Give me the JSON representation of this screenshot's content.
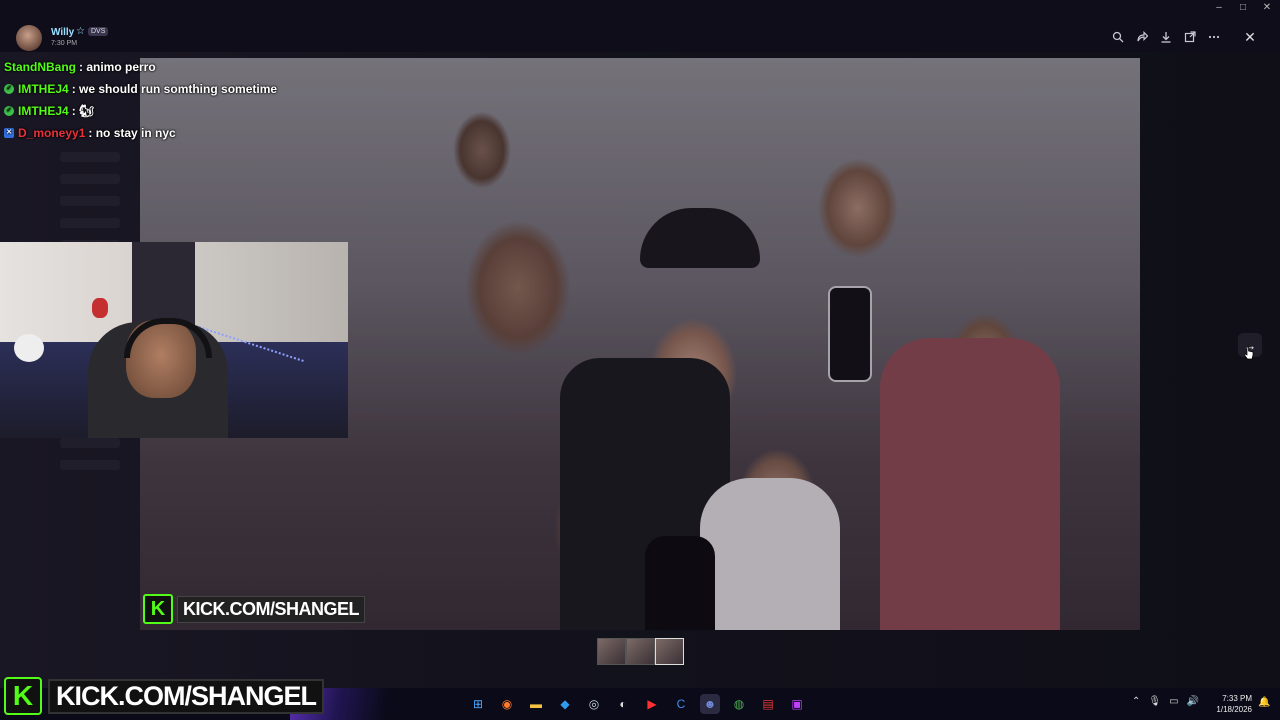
{
  "viewer": {
    "user_name": "Willy",
    "user_star": "☆",
    "user_badge": "DVS",
    "time": "7:30 PM",
    "toolbar_icons": [
      "zoom-icon",
      "share-icon",
      "download-icon",
      "open-external-icon",
      "more-icon"
    ],
    "close_label": "✕"
  },
  "window_controls": {
    "minimize": "–",
    "maximize": "□",
    "close": "✕"
  },
  "chat": {
    "messages": [
      {
        "user": "StandNBang",
        "color": "#53fc18",
        "badge": "",
        "text": ": animo perro"
      },
      {
        "user": "IMTHEJ4",
        "color": "#53fc18",
        "badge": "circle",
        "text": ": we should run somthing sometime"
      },
      {
        "user": "IMTHEJ4",
        "color": "#53fc18",
        "badge": "circle",
        "text": ": 🐿"
      },
      {
        "user": "D_moneyy1",
        "color": "#e8323a",
        "badge": "square",
        "text": ": no stay in nyc"
      }
    ]
  },
  "watermark": {
    "small": "KICK.COM/SHANGEL",
    "big": "KICK.COM/SHANGEL",
    "logo_letter": "K",
    "brand_color": "#53fc18"
  },
  "navigation": {
    "next_arrow": "→"
  },
  "thumbnails": {
    "count": 3
  },
  "taskbar": {
    "apps": [
      {
        "name": "windows-start-icon",
        "glyph": "⊞",
        "color": "#4aa8ff"
      },
      {
        "name": "firefox-icon",
        "glyph": "◉",
        "color": "#ff7a2e"
      },
      {
        "name": "file-explorer-icon",
        "glyph": "▬",
        "color": "#f5c242"
      },
      {
        "name": "vscode-icon",
        "glyph": "◆",
        "color": "#2f9cf0"
      },
      {
        "name": "steam-icon",
        "glyph": "◎",
        "color": "#c7d5e0"
      },
      {
        "name": "obs-icon",
        "glyph": "◐",
        "color": "#dddddd"
      },
      {
        "name": "youtube-icon",
        "glyph": "▶",
        "color": "#ff3030"
      },
      {
        "name": "ccleaner-icon",
        "glyph": "C",
        "color": "#3e8ef0"
      },
      {
        "name": "discord-icon",
        "glyph": "☻",
        "color": "#7289da"
      },
      {
        "name": "chrome-icon",
        "glyph": "◍",
        "color": "#4caf50"
      },
      {
        "name": "streamlabs-icon",
        "glyph": "▤",
        "color": "#e83a3a"
      },
      {
        "name": "ipod-app-icon",
        "glyph": "▣",
        "color": "#c040ff"
      }
    ],
    "tray": {
      "up_arrow": "⌃",
      "mic": "🎙",
      "network": "▭",
      "volume": "🔊"
    },
    "clock_time": "7:33 PM",
    "clock_date": "1/18/2026",
    "notification_icon": "🔔"
  }
}
